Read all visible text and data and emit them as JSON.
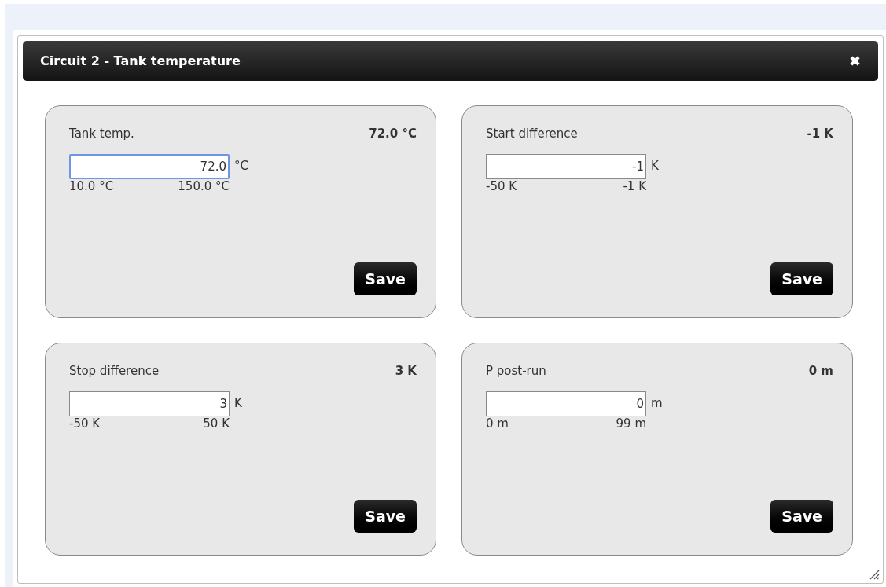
{
  "dialog": {
    "title": "Circuit 2 - Tank temperature",
    "close": "✖"
  },
  "settings": [
    {
      "label": "Tank temp.",
      "current": "72.0 °C",
      "value": "72.0",
      "unit": "°C",
      "min": "10.0 °C",
      "max": "150.0 °C",
      "focused": true,
      "button": "Save"
    },
    {
      "label": "Start difference",
      "current": "-1 K",
      "value": "-1",
      "unit": "K",
      "min": "-50 K",
      "max": "-1 K",
      "focused": false,
      "button": "Save"
    },
    {
      "label": "Stop difference",
      "current": "3 K",
      "value": "3",
      "unit": "K",
      "min": "-50 K",
      "max": "50 K",
      "focused": false,
      "button": "Save"
    },
    {
      "label": "P post-run",
      "current": "0 m",
      "value": "0",
      "unit": "m",
      "min": "0 m",
      "max": "99 m",
      "focused": false,
      "button": "Save"
    }
  ]
}
